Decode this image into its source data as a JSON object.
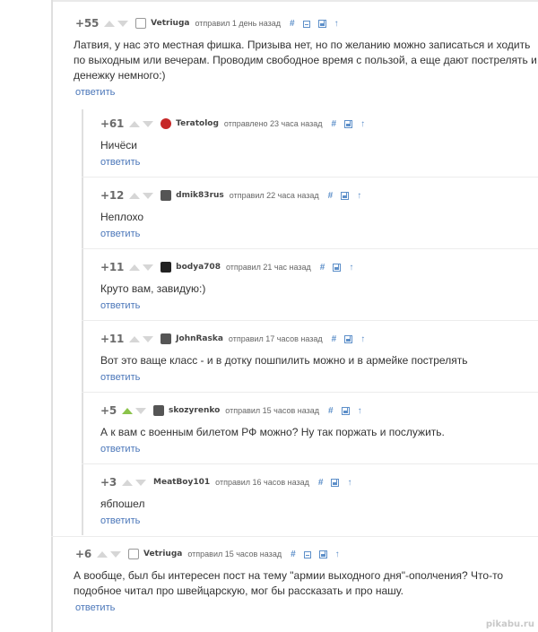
{
  "comments": [
    {
      "score": "+55",
      "vote_up_active": false,
      "avatar": "user-icon",
      "author": "Vetriuga",
      "meta": "отправил 1 день назад",
      "has_expand_icon": true,
      "text": "Латвия, у нас это местная фишка. Призыва нет, но по желанию можно записаться и ходить по выходным или вечерам. Проводим свободное время с пользой, а еще дают пострелять и денежку немного:)",
      "reply": "ответить"
    },
    {
      "score": "+61",
      "vote_up_active": false,
      "avatar": "demon-icon",
      "author": "Teratolog",
      "meta": "отправлено 23 часа назад",
      "has_expand_icon": false,
      "text": "Ничёси",
      "reply": "ответить"
    },
    {
      "score": "+12",
      "vote_up_active": false,
      "avatar": "photo-avatar-icon",
      "author": "dmik83rus",
      "meta": "отправил 22 часа назад",
      "has_expand_icon": false,
      "text": "Неплохо",
      "reply": "ответить"
    },
    {
      "score": "+11",
      "vote_up_active": false,
      "avatar": "skull-icon",
      "author": "bodya708",
      "meta": "отправил 21 час назад",
      "has_expand_icon": false,
      "text": "Круто вам, завидую:)",
      "reply": "ответить"
    },
    {
      "score": "+11",
      "vote_up_active": false,
      "avatar": "photo-avatar-icon",
      "author": "JohnRaska",
      "meta": "отправил 17 часов назад",
      "has_expand_icon": false,
      "text": "Вот это ваще класс - и в дотку пошпилить можно и в армейке пострелять",
      "reply": "ответить"
    },
    {
      "score": "+5",
      "vote_up_active": true,
      "avatar": "photo-avatar-icon",
      "author": "skozyrenko",
      "meta": "отправил 15 часов назад",
      "has_expand_icon": false,
      "text": "А к вам с военным билетом РФ можно? Ну так поржать и послужить.",
      "reply": "ответить"
    },
    {
      "score": "+3",
      "vote_up_active": false,
      "avatar": "none",
      "author": "MeatBoy101",
      "meta": "отправил 16 часов назад",
      "has_expand_icon": false,
      "text": "ябпошел",
      "reply": "ответить"
    },
    {
      "score": "+6",
      "vote_up_active": false,
      "avatar": "user-icon",
      "author": "Vetriuga",
      "meta": "отправил 15 часов назад",
      "has_expand_icon": true,
      "text": "А вообще, был бы интересен пост на тему \"армии выходного дня\"-ополчения? Что-то подобное читал про швейцарскую, мог бы рассказать и про нашу.",
      "reply": "ответить"
    }
  ],
  "icons": {
    "hash": "#",
    "up": "↑"
  },
  "colors": {
    "link": "#4a76b9",
    "icon": "#5d8fc9",
    "vote_up_active": "#8bc34a",
    "vote_neutral": "#d6d6d6"
  },
  "watermark": "pikabu.ru"
}
